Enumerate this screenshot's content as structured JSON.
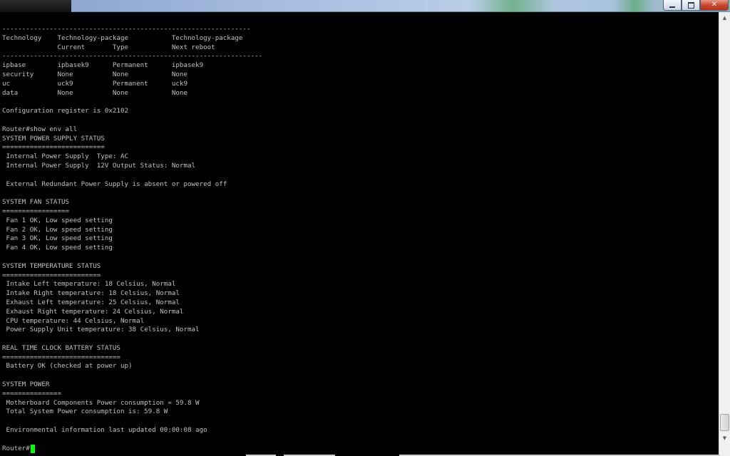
{
  "window": {
    "controls": {
      "minimize_icon": "minimize-icon",
      "maximize_icon": "restore-icon",
      "close_label": "✕"
    }
  },
  "terminal": {
    "lines": [
      "---------------------------------------------------------------",
      "Technology    Technology-package           Technology-package",
      "              Current       Type           Next reboot",
      "------------------------------------------------------------------",
      "ipbase        ipbasek9      Permanent      ipbasek9",
      "security      None          None           None",
      "uc            uck9          Permanent      uck9",
      "data          None          None           None",
      "",
      "Configuration register is 0x2102",
      "",
      "Router#show env all",
      "SYSTEM POWER SUPPLY STATUS",
      "==========================",
      " Internal Power Supply  Type: AC",
      " Internal Power Supply  12V Output Status: Normal",
      "",
      " External Redundant Power Supply is absent or powered off",
      "",
      "SYSTEM FAN STATUS",
      "=================",
      " Fan 1 OK, Low speed setting",
      " Fan 2 OK, Low speed setting",
      " Fan 3 OK, Low speed setting",
      " Fan 4 OK, Low speed setting",
      "",
      "SYSTEM TEMPERATURE STATUS",
      "=========================",
      " Intake Left temperature: 18 Celsius, Normal",
      " Intake Right temperature: 18 Celsius, Normal",
      " Exhaust Left temperature: 25 Celsius, Normal",
      " Exhaust Right temperature: 24 Celsius, Normal",
      " CPU temperature: 44 Celsius, Normal",
      " Power Supply Unit temperature: 38 Celsius, Normal",
      "",
      "REAL TIME CLOCK BATTERY STATUS",
      "==============================",
      " Battery OK (checked at power up)",
      "",
      "SYSTEM POWER",
      "===============",
      " Motherboard Components Power consumption = 59.8 W",
      " Total System Power consumption is: 59.8 W",
      "",
      " Environmental information last updated 00:00:08 ago",
      ""
    ],
    "prompt": "Router#"
  },
  "scrollbar": {
    "up_icon": "scroll-up-arrow-icon",
    "down_icon": "scroll-down-arrow-icon"
  },
  "colors": {
    "background": "#000000",
    "text": "#c0c0c0",
    "cursor": "#00ff00"
  }
}
